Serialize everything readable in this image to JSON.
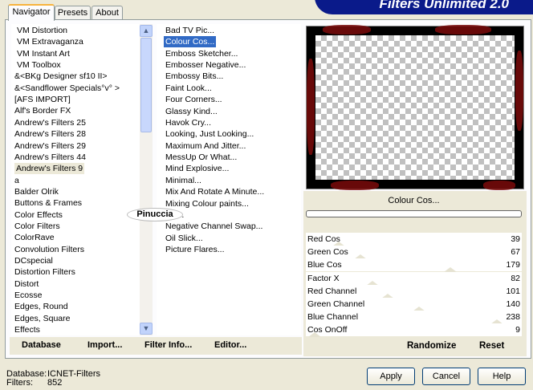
{
  "app": {
    "title": "Filters Unlimited 2.0"
  },
  "tabs": [
    {
      "label": "Navigator",
      "active": true
    },
    {
      "label": "Presets"
    },
    {
      "label": "About"
    }
  ],
  "categories": [
    "VM Distortion",
    "VM Extravaganza",
    "VM Instant Art",
    "VM Toolbox",
    "&<BKg Designer sf10 II>",
    "&<Sandflower Specials°v° >",
    "[AFS IMPORT]",
    "Alf's Border FX",
    "Andrew's Filters 25",
    "Andrew's Filters 28",
    "Andrew's Filters 29",
    "Andrew's Filters 44",
    "Andrew's Filters 9",
    "a",
    "Balder Olrik",
    "Buttons & Frames",
    "Color Effects",
    "Color Filters",
    "ColorRave",
    "Convolution Filters",
    "DCspecial",
    "Distortion Filters",
    "Distort",
    "Ecosse",
    "Edges, Round",
    "Edges, Square",
    "Effects"
  ],
  "selected_category": "Andrew's Filters 9",
  "filters": [
    "Bad TV Pic...",
    "Colour Cos...",
    "Emboss Sketcher...",
    "Embosser Negative...",
    "Embossy Bits...",
    "Faint Look...",
    "Four Corners...",
    "Glassy Kind...",
    "Havok Cry...",
    "Looking, Just Looking...",
    "Maximum And Jitter...",
    "MessUp Or What...",
    "Mind Explosive...",
    "Minimal...",
    "Mix And Rotate A Minute...",
    "Mixing Colour paints...",
    "...g...",
    "Negative Channel Swap...",
    "Oil Slick...",
    "Picture Flares..."
  ],
  "selected_filter": "Colour Cos...",
  "watermark": "Pinuccia",
  "list_buttons": {
    "database": "Database",
    "import": "Import...",
    "filter_info": "Filter Info...",
    "editor": "Editor..."
  },
  "preview": {
    "filter_name": "Colour Cos..."
  },
  "params": [
    {
      "label": "Red Cos",
      "value": 39
    },
    {
      "label": "Green Cos",
      "value": 67
    },
    {
      "label": "Blue Cos",
      "value": 179
    },
    {
      "label": "Factor X",
      "value": 82
    },
    {
      "label": "Red Channel",
      "value": 101
    },
    {
      "label": "Green Channel",
      "value": 140
    },
    {
      "label": "Blue Channel",
      "value": 238
    },
    {
      "label": "Cos OnOff",
      "value": 9
    }
  ],
  "param_buttons": {
    "randomize": "Randomize",
    "reset": "Reset"
  },
  "status": {
    "database_label": "Database:",
    "database_value": "ICNET-Filters",
    "filters_label": "Filters:",
    "filters_value": "852"
  },
  "dialog_buttons": {
    "apply": "Apply",
    "cancel": "Cancel",
    "help": "Help"
  },
  "colors": {
    "selection": "#316ac5",
    "banner": "#0a1a8a",
    "window": "#ece9d8"
  }
}
